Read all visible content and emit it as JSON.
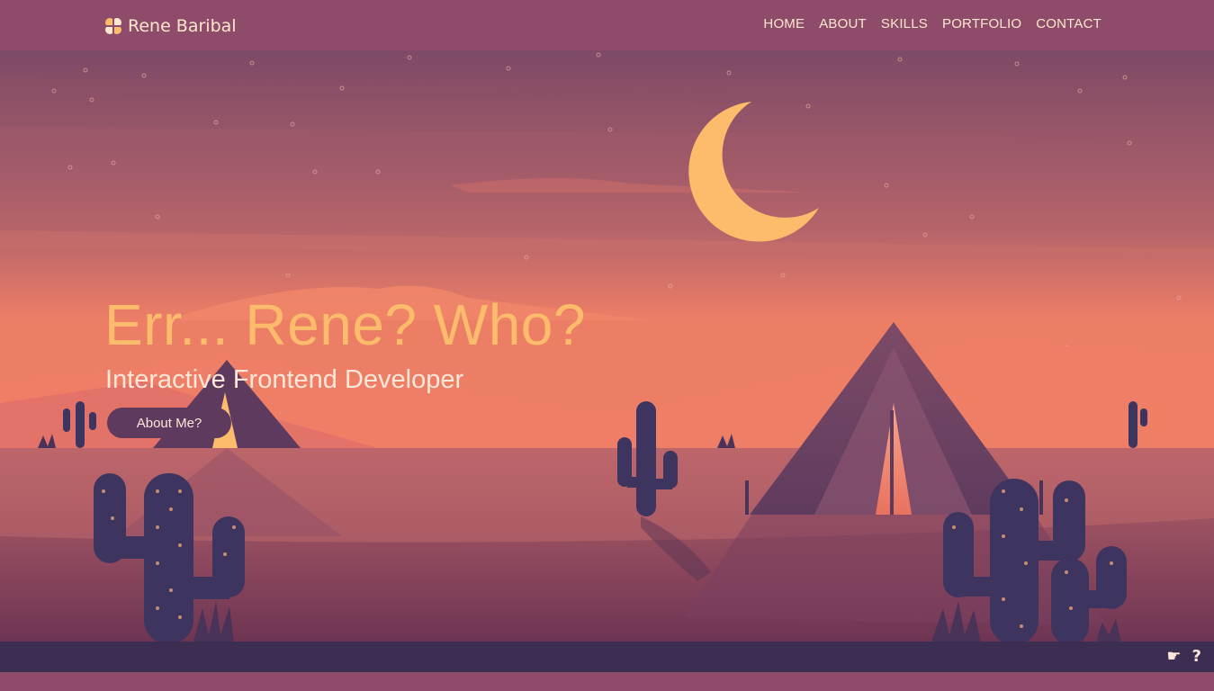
{
  "nav": {
    "brand": "Rene Baribal",
    "brand_icon": "clover-logo-icon",
    "links": [
      "HOME",
      "ABOUT",
      "SKILLS",
      "PORTFOLIO",
      "CONTACT"
    ]
  },
  "hero": {
    "title": "Err... Rene? Who?",
    "subtitle": "Interactive Frontend Developer",
    "cta": "About Me?"
  },
  "footer": {
    "icons": [
      "pointing-hand-icon",
      "question-icon"
    ],
    "hand_glyph": "☛",
    "question_glyph": "?"
  },
  "colors": {
    "nav_bg": "#8f4c6a",
    "accent": "#fdbc6c",
    "text_light": "#fde7d8",
    "button_bg": "#5e3a5f",
    "footer_bg": "#3b2e52",
    "cactus": "#3d3560"
  }
}
